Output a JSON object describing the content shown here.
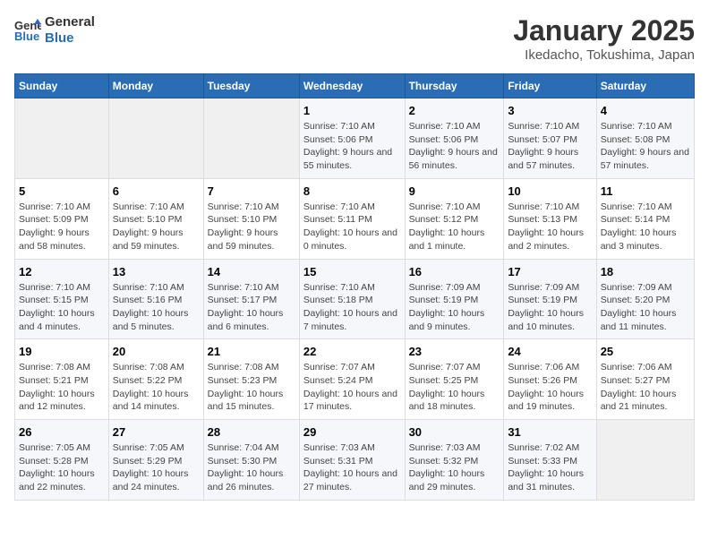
{
  "logo": {
    "line1": "General",
    "line2": "Blue"
  },
  "title": "January 2025",
  "subtitle": "Ikedacho, Tokushima, Japan",
  "headers": [
    "Sunday",
    "Monday",
    "Tuesday",
    "Wednesday",
    "Thursday",
    "Friday",
    "Saturday"
  ],
  "weeks": [
    [
      {
        "day": "",
        "info": ""
      },
      {
        "day": "",
        "info": ""
      },
      {
        "day": "",
        "info": ""
      },
      {
        "day": "1",
        "info": "Sunrise: 7:10 AM\nSunset: 5:06 PM\nDaylight: 9 hours and 55 minutes."
      },
      {
        "day": "2",
        "info": "Sunrise: 7:10 AM\nSunset: 5:06 PM\nDaylight: 9 hours and 56 minutes."
      },
      {
        "day": "3",
        "info": "Sunrise: 7:10 AM\nSunset: 5:07 PM\nDaylight: 9 hours and 57 minutes."
      },
      {
        "day": "4",
        "info": "Sunrise: 7:10 AM\nSunset: 5:08 PM\nDaylight: 9 hours and 57 minutes."
      }
    ],
    [
      {
        "day": "5",
        "info": "Sunrise: 7:10 AM\nSunset: 5:09 PM\nDaylight: 9 hours and 58 minutes."
      },
      {
        "day": "6",
        "info": "Sunrise: 7:10 AM\nSunset: 5:10 PM\nDaylight: 9 hours and 59 minutes."
      },
      {
        "day": "7",
        "info": "Sunrise: 7:10 AM\nSunset: 5:10 PM\nDaylight: 9 hours and 59 minutes."
      },
      {
        "day": "8",
        "info": "Sunrise: 7:10 AM\nSunset: 5:11 PM\nDaylight: 10 hours and 0 minutes."
      },
      {
        "day": "9",
        "info": "Sunrise: 7:10 AM\nSunset: 5:12 PM\nDaylight: 10 hours and 1 minute."
      },
      {
        "day": "10",
        "info": "Sunrise: 7:10 AM\nSunset: 5:13 PM\nDaylight: 10 hours and 2 minutes."
      },
      {
        "day": "11",
        "info": "Sunrise: 7:10 AM\nSunset: 5:14 PM\nDaylight: 10 hours and 3 minutes."
      }
    ],
    [
      {
        "day": "12",
        "info": "Sunrise: 7:10 AM\nSunset: 5:15 PM\nDaylight: 10 hours and 4 minutes."
      },
      {
        "day": "13",
        "info": "Sunrise: 7:10 AM\nSunset: 5:16 PM\nDaylight: 10 hours and 5 minutes."
      },
      {
        "day": "14",
        "info": "Sunrise: 7:10 AM\nSunset: 5:17 PM\nDaylight: 10 hours and 6 minutes."
      },
      {
        "day": "15",
        "info": "Sunrise: 7:10 AM\nSunset: 5:18 PM\nDaylight: 10 hours and 7 minutes."
      },
      {
        "day": "16",
        "info": "Sunrise: 7:09 AM\nSunset: 5:19 PM\nDaylight: 10 hours and 9 minutes."
      },
      {
        "day": "17",
        "info": "Sunrise: 7:09 AM\nSunset: 5:19 PM\nDaylight: 10 hours and 10 minutes."
      },
      {
        "day": "18",
        "info": "Sunrise: 7:09 AM\nSunset: 5:20 PM\nDaylight: 10 hours and 11 minutes."
      }
    ],
    [
      {
        "day": "19",
        "info": "Sunrise: 7:08 AM\nSunset: 5:21 PM\nDaylight: 10 hours and 12 minutes."
      },
      {
        "day": "20",
        "info": "Sunrise: 7:08 AM\nSunset: 5:22 PM\nDaylight: 10 hours and 14 minutes."
      },
      {
        "day": "21",
        "info": "Sunrise: 7:08 AM\nSunset: 5:23 PM\nDaylight: 10 hours and 15 minutes."
      },
      {
        "day": "22",
        "info": "Sunrise: 7:07 AM\nSunset: 5:24 PM\nDaylight: 10 hours and 17 minutes."
      },
      {
        "day": "23",
        "info": "Sunrise: 7:07 AM\nSunset: 5:25 PM\nDaylight: 10 hours and 18 minutes."
      },
      {
        "day": "24",
        "info": "Sunrise: 7:06 AM\nSunset: 5:26 PM\nDaylight: 10 hours and 19 minutes."
      },
      {
        "day": "25",
        "info": "Sunrise: 7:06 AM\nSunset: 5:27 PM\nDaylight: 10 hours and 21 minutes."
      }
    ],
    [
      {
        "day": "26",
        "info": "Sunrise: 7:05 AM\nSunset: 5:28 PM\nDaylight: 10 hours and 22 minutes."
      },
      {
        "day": "27",
        "info": "Sunrise: 7:05 AM\nSunset: 5:29 PM\nDaylight: 10 hours and 24 minutes."
      },
      {
        "day": "28",
        "info": "Sunrise: 7:04 AM\nSunset: 5:30 PM\nDaylight: 10 hours and 26 minutes."
      },
      {
        "day": "29",
        "info": "Sunrise: 7:03 AM\nSunset: 5:31 PM\nDaylight: 10 hours and 27 minutes."
      },
      {
        "day": "30",
        "info": "Sunrise: 7:03 AM\nSunset: 5:32 PM\nDaylight: 10 hours and 29 minutes."
      },
      {
        "day": "31",
        "info": "Sunrise: 7:02 AM\nSunset: 5:33 PM\nDaylight: 10 hours and 31 minutes."
      },
      {
        "day": "",
        "info": ""
      }
    ]
  ]
}
